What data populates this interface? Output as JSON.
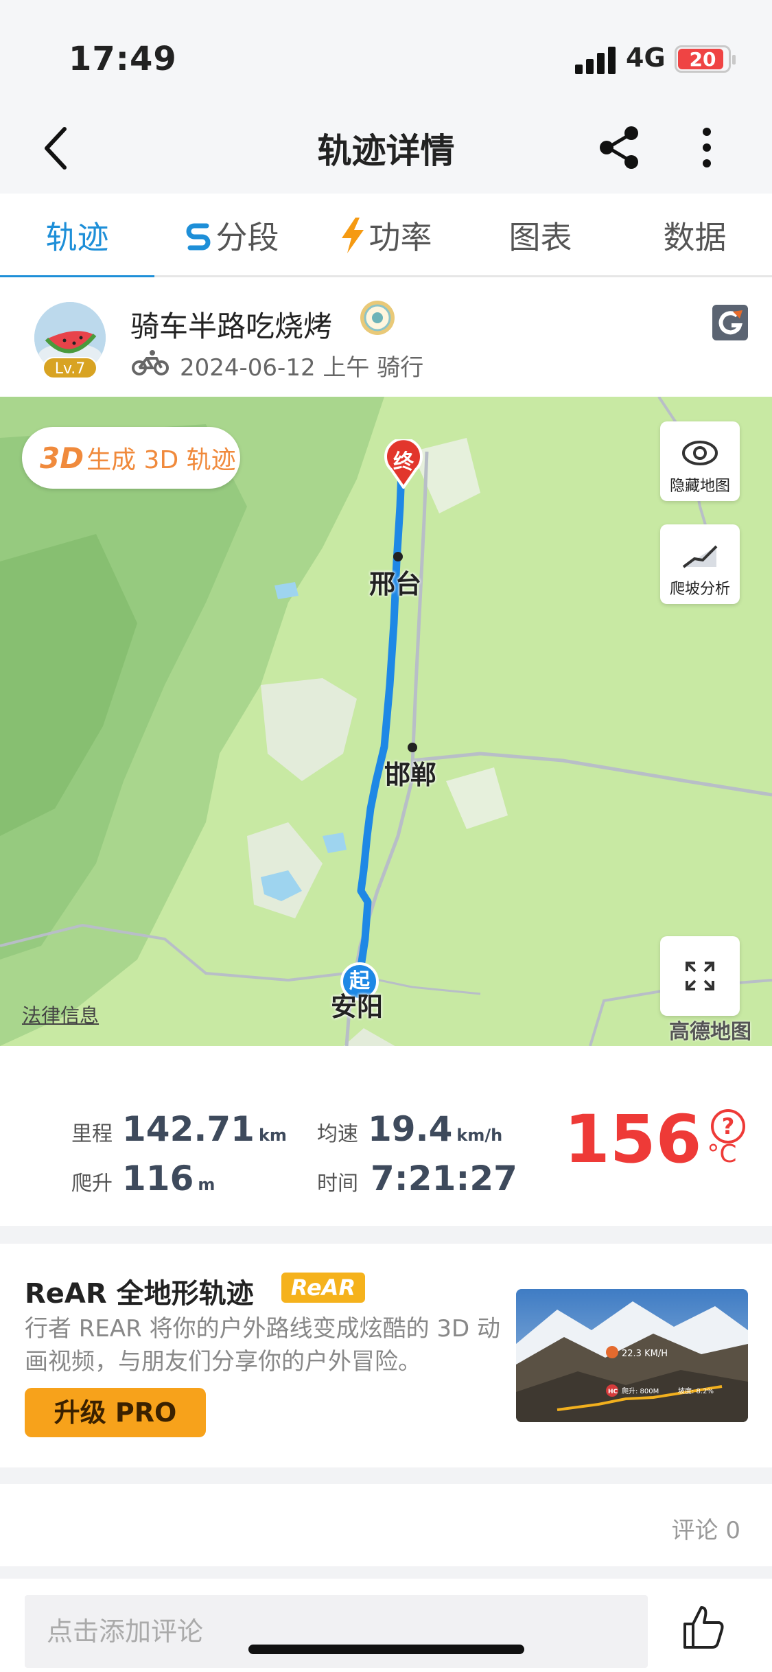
{
  "status_bar": {
    "time": "17:49",
    "network": "4G",
    "battery": "20"
  },
  "nav": {
    "title": "轨迹详情",
    "back_icon": "chevron-left-icon",
    "share_icon": "share-icon",
    "more_icon": "more-vertical-icon"
  },
  "tabs": [
    {
      "label": "轨迹",
      "active": true
    },
    {
      "label": "分段",
      "icon": "segment-icon"
    },
    {
      "label": "功率",
      "icon": "lightning-icon"
    },
    {
      "label": "图表"
    },
    {
      "label": "数据"
    }
  ],
  "profile": {
    "name": "骑车半路吃烧烤",
    "level": "Lv.7",
    "date": "2024-06-12 上午 骑行"
  },
  "map": {
    "btn_3d_prefix": "3D",
    "btn_3d_text": "生成 3D 轨迹",
    "hide_map_label": "隐藏地图",
    "climb_label": "爬坡分析",
    "city_xingtai": "邢台",
    "city_handan": "邯郸",
    "city_anyang": "安阳",
    "end_marker": "终",
    "start_marker": "起",
    "legal_link": "法律信息",
    "provider": "高德地图",
    "route_color": "#1e88e5"
  },
  "stats": {
    "distance_label": "里程",
    "distance_value": "142.71",
    "distance_unit": "km",
    "speed_label": "均速",
    "speed_value": "19.4",
    "speed_unit": "km/h",
    "climb_label": "爬升",
    "climb_value": "116",
    "climb_unit": "m",
    "time_label": "时间",
    "time_value": "7:21:27",
    "temp_value": "156",
    "temp_unit": "°C",
    "help": "?"
  },
  "promo": {
    "title": "ReAR 全地形轨迹",
    "badge": "ReAR",
    "desc": "行者 REAR 将你的户外路线变成炫酷的 3D 动画视频，与朋友们分享你的户外冒险。",
    "button": "升级 PRO",
    "img_speed": "22.3 KM/H",
    "img_climb": "爬升: 800M",
    "img_grade": "坡度: 8.2%",
    "img_tag": "HC"
  },
  "comments": {
    "count_label": "评论 0",
    "input_placeholder": "点击添加评论"
  }
}
